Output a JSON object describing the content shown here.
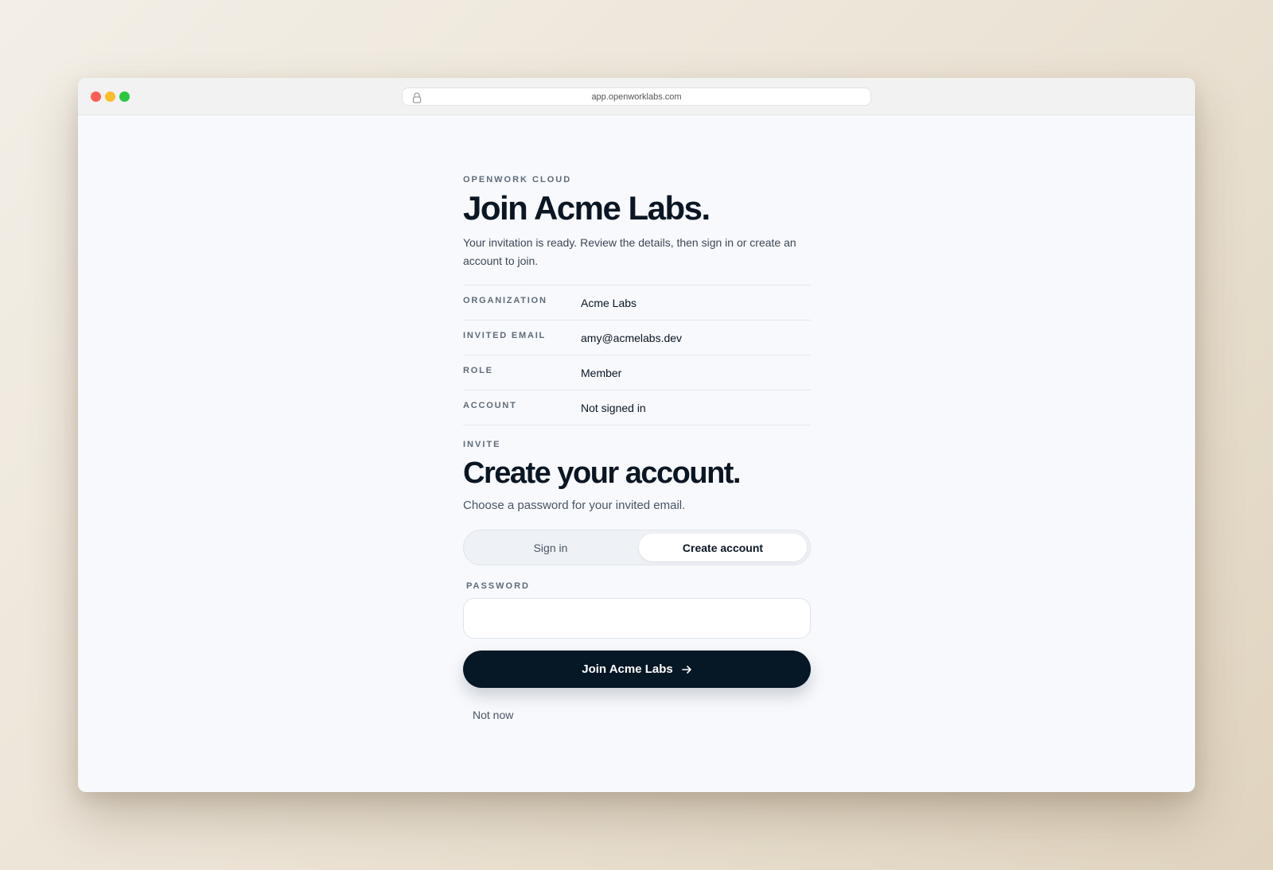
{
  "browser": {
    "url": "app.openworklabs.com"
  },
  "header": {
    "eyebrow": "OPENWORK CLOUD",
    "title": "Join Acme Labs.",
    "intro": "Your invitation is ready. Review the details, then sign in or create an account to join."
  },
  "details": [
    {
      "key": "ORGANIZATION",
      "value": "Acme Labs"
    },
    {
      "key": "INVITED EMAIL",
      "value": "amy@acmelabs.dev"
    },
    {
      "key": "ROLE",
      "value": "Member"
    },
    {
      "key": "ACCOUNT",
      "value": "Not signed in"
    }
  ],
  "form": {
    "section_label": "INVITE",
    "title": "Create your account.",
    "subtitle": "Choose a password for your invited email.",
    "tabs": {
      "sign_in": "Sign in",
      "create_account": "Create account",
      "active": "create_account"
    },
    "password_label": "PASSWORD",
    "password_value": "",
    "submit_label": "Join Acme Labs",
    "secondary_label": "Not now"
  },
  "colors": {
    "primary_button": "#061726",
    "page_bg": "#f7f9fc",
    "heading": "#0b1624"
  }
}
